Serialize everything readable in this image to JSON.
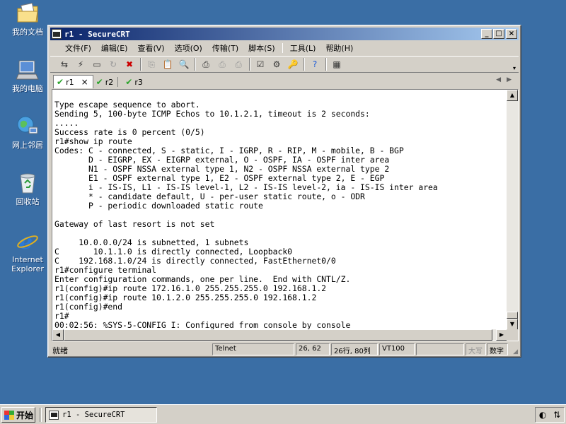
{
  "desktop": {
    "icons": [
      {
        "label": "我的文档",
        "icon": "folder-documents-icon"
      },
      {
        "label": "我的电脑",
        "icon": "computer-icon"
      },
      {
        "label": "网上邻居",
        "icon": "network-icon"
      },
      {
        "label": "回收站",
        "icon": "recycle-bin-icon"
      },
      {
        "label": "Internet Explorer",
        "icon": "internet-explorer-icon"
      }
    ]
  },
  "window": {
    "title": "r1 - SecureCRT",
    "buttons": {
      "minimize": "_",
      "maximize": "□",
      "close": "×"
    }
  },
  "menu": {
    "items": [
      "文件(F)",
      "编辑(E)",
      "查看(V)",
      "选项(O)",
      "传输(T)",
      "脚本(S)",
      "工具(L)",
      "帮助(H)"
    ]
  },
  "toolbar": {
    "tools": [
      "connect-icon",
      "quick-connect-icon",
      "connect-tab-icon",
      "reconnect-icon",
      "disconnect-icon",
      "copy-icon",
      "paste-icon",
      "find-icon",
      "print-icon",
      "print-selection-icon",
      "print-setup-icon",
      "session-options-icon",
      "global-options-icon",
      "keymap-icon",
      "help-icon",
      "about-icon"
    ]
  },
  "tabs": [
    {
      "label": "r1",
      "active": true,
      "close": "×"
    },
    {
      "label": "r2",
      "active": false
    },
    {
      "label": "r3",
      "active": false
    }
  ],
  "terminal": {
    "lines": [
      "Type escape sequence to abort.",
      "Sending 5, 100-byte ICMP Echos to 10.1.2.1, timeout is 2 seconds:",
      ".....",
      "Success rate is 0 percent (0/5)",
      "r1#show ip route",
      "Codes: C - connected, S - static, I - IGRP, R - RIP, M - mobile, B - BGP",
      "       D - EIGRP, EX - EIGRP external, O - OSPF, IA - OSPF inter area",
      "       N1 - OSPF NSSA external type 1, N2 - OSPF NSSA external type 2",
      "       E1 - OSPF external type 1, E2 - OSPF external type 2, E - EGP",
      "       i - IS-IS, L1 - IS-IS level-1, L2 - IS-IS level-2, ia - IS-IS inter area",
      "       * - candidate default, U - per-user static route, o - ODR",
      "       P - periodic downloaded static route",
      "",
      "Gateway of last resort is not set",
      "",
      "     10.0.0.0/24 is subnetted, 1 subnets",
      "C       10.1.1.0 is directly connected, Loopback0",
      "C    192.168.1.0/24 is directly connected, FastEthernet0/0",
      "r1#configure terminal",
      "Enter configuration commands, one per line.  End with CNTL/Z.",
      "r1(config)#ip route 172.16.1.0 255.255.255.0 192.168.1.2",
      "r1(config)#ip route 10.1.2.0 255.255.255.0 192.168.1.2",
      "r1(config)#end",
      "r1#",
      "00:02:56: %SYS-5-CONFIG_I: Configured from console by console"
    ]
  },
  "status": {
    "ready": "就绪",
    "protocol": "Telnet",
    "cursor": "26, 62",
    "size": "26行, 80列",
    "emulation": "VT100",
    "empty": "",
    "caps": "大写",
    "num": "数字"
  },
  "taskbar": {
    "start": "开始",
    "task_title": "r1 - SecureCRT"
  }
}
